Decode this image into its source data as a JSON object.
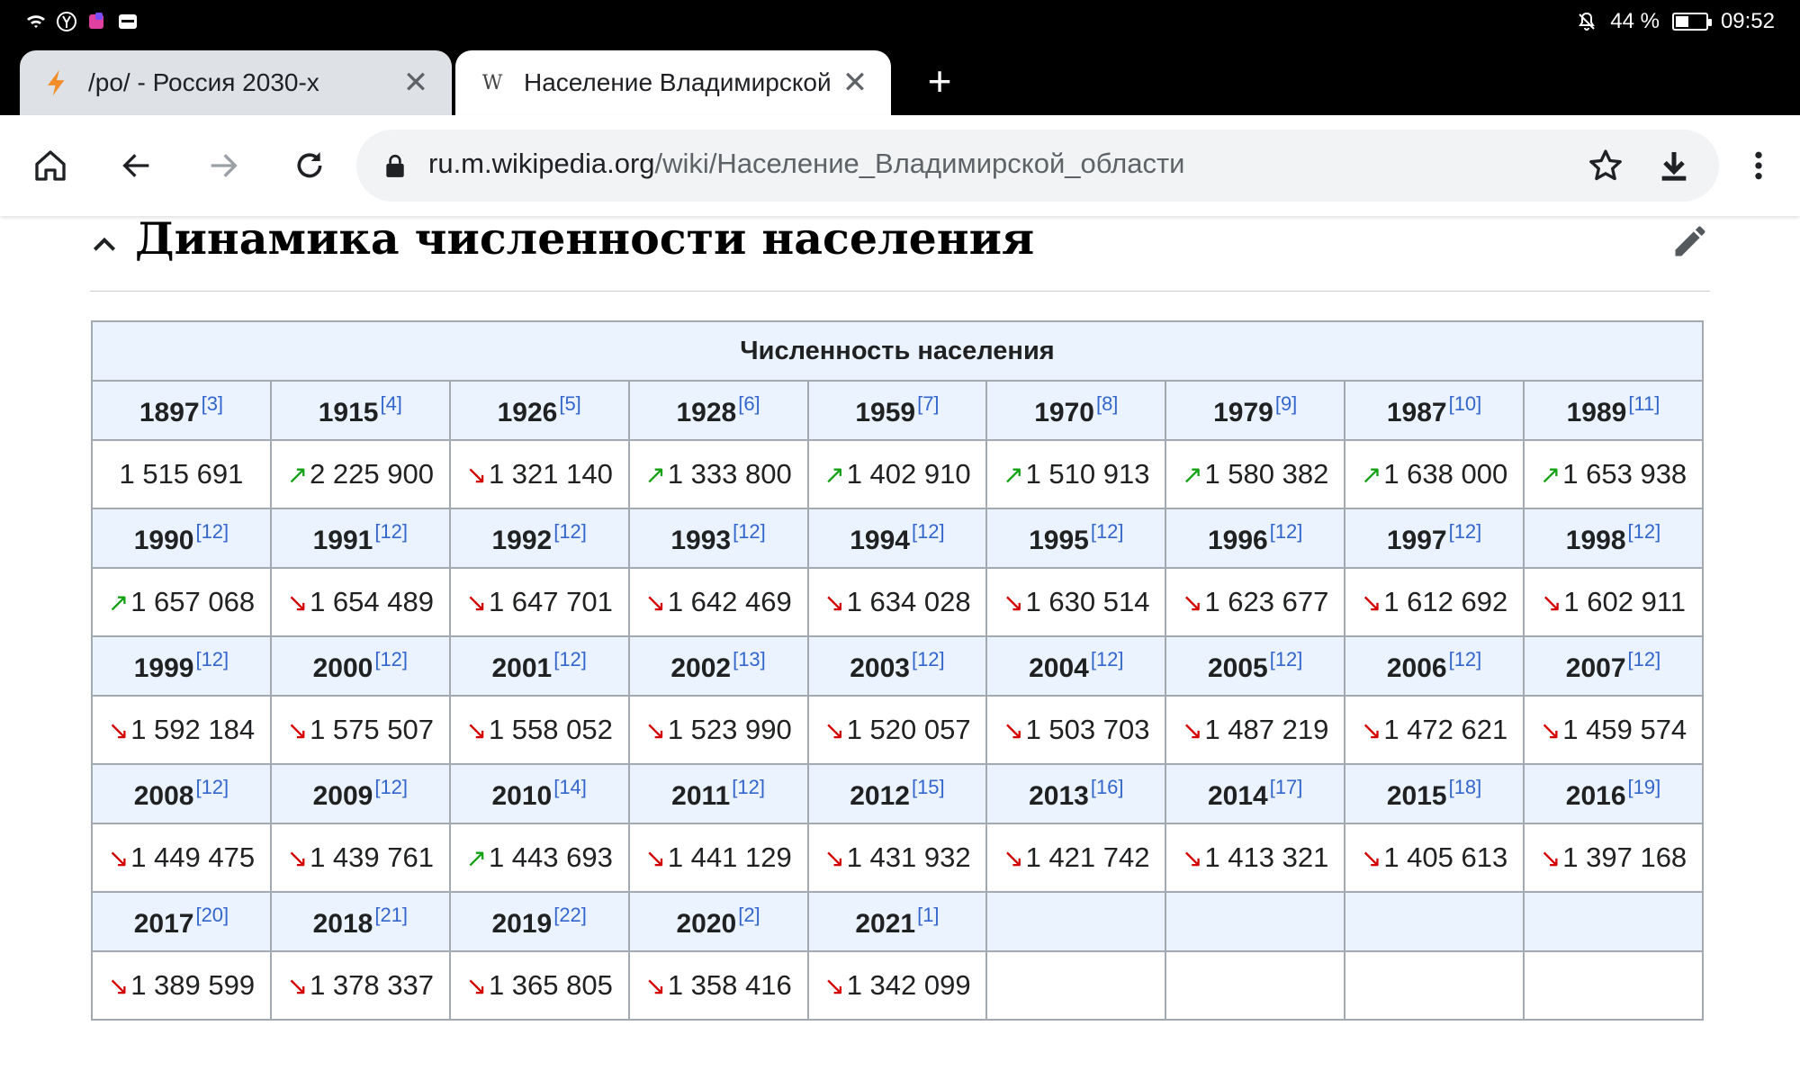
{
  "status_bar": {
    "battery_percent": "44 %",
    "battery_level": 0.44,
    "time": "09:52",
    "icons": [
      "wifi-icon",
      "yandex-icon",
      "app-icon",
      "hms-icon",
      "mute-icon"
    ]
  },
  "tabs": [
    {
      "title": "/po/ - Россия 2030-х",
      "favicon": "lightning-icon",
      "active": false
    },
    {
      "title": "Население Владимирской",
      "favicon": "W",
      "active": true
    }
  ],
  "toolbar": {
    "url_host": "ru.m.wikipedia.org",
    "url_path": "/wiki/Население_Владимирской_области"
  },
  "section": {
    "title": "Динамика численности населения"
  },
  "table": {
    "caption": "Численность населения",
    "rows": [
      [
        {
          "year": "1897",
          "ref": "[3]",
          "value": "1 515 691",
          "trend": ""
        },
        {
          "year": "1915",
          "ref": "[4]",
          "value": "2 225 900",
          "trend": "up"
        },
        {
          "year": "1926",
          "ref": "[5]",
          "value": "1 321 140",
          "trend": "down"
        },
        {
          "year": "1928",
          "ref": "[6]",
          "value": "1 333 800",
          "trend": "up"
        },
        {
          "year": "1959",
          "ref": "[7]",
          "value": "1 402 910",
          "trend": "up"
        },
        {
          "year": "1970",
          "ref": "[8]",
          "value": "1 510 913",
          "trend": "up"
        },
        {
          "year": "1979",
          "ref": "[9]",
          "value": "1 580 382",
          "trend": "up"
        },
        {
          "year": "1987",
          "ref": "[10]",
          "value": "1 638 000",
          "trend": "up"
        },
        {
          "year": "1989",
          "ref": "[11]",
          "value": "1 653 938",
          "trend": "up"
        }
      ],
      [
        {
          "year": "1990",
          "ref": "[12]",
          "value": "1 657 068",
          "trend": "up"
        },
        {
          "year": "1991",
          "ref": "[12]",
          "value": "1 654 489",
          "trend": "down"
        },
        {
          "year": "1992",
          "ref": "[12]",
          "value": "1 647 701",
          "trend": "down"
        },
        {
          "year": "1993",
          "ref": "[12]",
          "value": "1 642 469",
          "trend": "down"
        },
        {
          "year": "1994",
          "ref": "[12]",
          "value": "1 634 028",
          "trend": "down"
        },
        {
          "year": "1995",
          "ref": "[12]",
          "value": "1 630 514",
          "trend": "down"
        },
        {
          "year": "1996",
          "ref": "[12]",
          "value": "1 623 677",
          "trend": "down"
        },
        {
          "year": "1997",
          "ref": "[12]",
          "value": "1 612 692",
          "trend": "down"
        },
        {
          "year": "1998",
          "ref": "[12]",
          "value": "1 602 911",
          "trend": "down"
        }
      ],
      [
        {
          "year": "1999",
          "ref": "[12]",
          "value": "1 592 184",
          "trend": "down"
        },
        {
          "year": "2000",
          "ref": "[12]",
          "value": "1 575 507",
          "trend": "down"
        },
        {
          "year": "2001",
          "ref": "[12]",
          "value": "1 558 052",
          "trend": "down"
        },
        {
          "year": "2002",
          "ref": "[13]",
          "value": "1 523 990",
          "trend": "down"
        },
        {
          "year": "2003",
          "ref": "[12]",
          "value": "1 520 057",
          "trend": "down"
        },
        {
          "year": "2004",
          "ref": "[12]",
          "value": "1 503 703",
          "trend": "down"
        },
        {
          "year": "2005",
          "ref": "[12]",
          "value": "1 487 219",
          "trend": "down"
        },
        {
          "year": "2006",
          "ref": "[12]",
          "value": "1 472 621",
          "trend": "down"
        },
        {
          "year": "2007",
          "ref": "[12]",
          "value": "1 459 574",
          "trend": "down"
        }
      ],
      [
        {
          "year": "2008",
          "ref": "[12]",
          "value": "1 449 475",
          "trend": "down"
        },
        {
          "year": "2009",
          "ref": "[12]",
          "value": "1 439 761",
          "trend": "down"
        },
        {
          "year": "2010",
          "ref": "[14]",
          "value": "1 443 693",
          "trend": "up"
        },
        {
          "year": "2011",
          "ref": "[12]",
          "value": "1 441 129",
          "trend": "down"
        },
        {
          "year": "2012",
          "ref": "[15]",
          "value": "1 431 932",
          "trend": "down"
        },
        {
          "year": "2013",
          "ref": "[16]",
          "value": "1 421 742",
          "trend": "down"
        },
        {
          "year": "2014",
          "ref": "[17]",
          "value": "1 413 321",
          "trend": "down"
        },
        {
          "year": "2015",
          "ref": "[18]",
          "value": "1 405 613",
          "trend": "down"
        },
        {
          "year": "2016",
          "ref": "[19]",
          "value": "1 397 168",
          "trend": "down"
        }
      ],
      [
        {
          "year": "2017",
          "ref": "[20]",
          "value": "1 389 599",
          "trend": "down"
        },
        {
          "year": "2018",
          "ref": "[21]",
          "value": "1 378 337",
          "trend": "down"
        },
        {
          "year": "2019",
          "ref": "[22]",
          "value": "1 365 805",
          "trend": "down"
        },
        {
          "year": "2020",
          "ref": "[2]",
          "value": "1 358 416",
          "trend": "down"
        },
        {
          "year": "2021",
          "ref": "[1]",
          "value": "1 342 099",
          "trend": "down"
        },
        {
          "year": "",
          "ref": "",
          "value": "",
          "trend": ""
        },
        {
          "year": "",
          "ref": "",
          "value": "",
          "trend": ""
        },
        {
          "year": "",
          "ref": "",
          "value": "",
          "trend": ""
        },
        {
          "year": "",
          "ref": "",
          "value": "",
          "trend": ""
        }
      ]
    ],
    "trend_colors": {
      "up": "#14a114",
      "down": "#d40000"
    },
    "trend_glyphs": {
      "up": "↗",
      "down": "↘"
    }
  }
}
